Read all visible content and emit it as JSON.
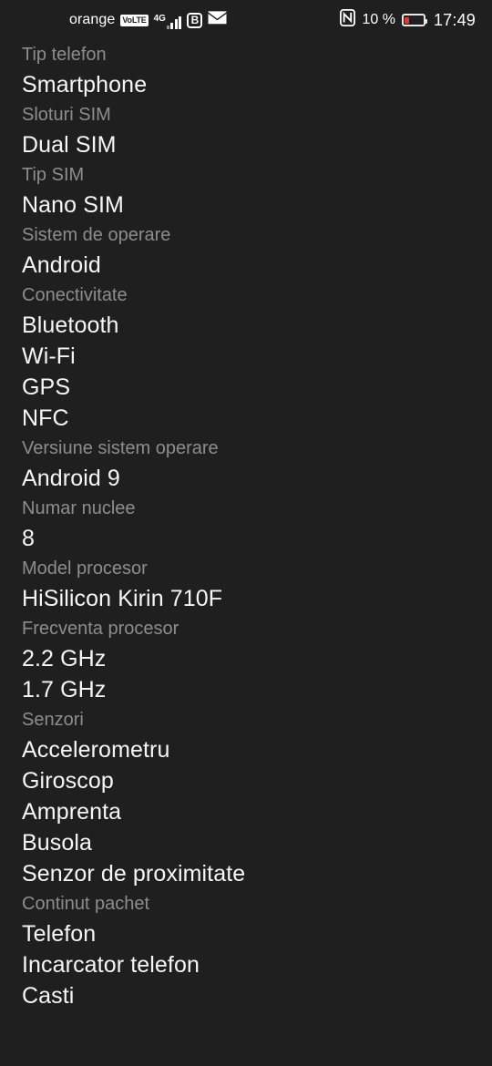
{
  "status_bar": {
    "carrier": "orange",
    "volte_badge": "VoLTE",
    "network_type": "4G",
    "signal_icon": "signal-bars-icon",
    "browser_badge": "B",
    "mail_icon": "envelope-icon",
    "nfc_icon": "nfc-icon",
    "battery_percent": "10 %",
    "battery_icon": "battery-low-icon",
    "battery_level": 10,
    "battery_color": "#e23b2e",
    "clock": "17:49"
  },
  "theme": {
    "background": "#1f1f1f",
    "label_color": "#8d8d8d",
    "value_color": "#f6f6f6"
  },
  "specs": [
    {
      "label": "Tip telefon",
      "values": [
        "Smartphone"
      ]
    },
    {
      "label": "Sloturi SIM",
      "values": [
        "Dual SIM"
      ]
    },
    {
      "label": "Tip SIM",
      "values": [
        "Nano SIM"
      ]
    },
    {
      "label": "Sistem de operare",
      "values": [
        "Android"
      ]
    },
    {
      "label": "Conectivitate",
      "values": [
        "Bluetooth",
        "Wi-Fi",
        "GPS",
        "NFC"
      ]
    },
    {
      "label": "Versiune sistem operare",
      "values": [
        "Android 9"
      ]
    },
    {
      "label": "Numar nuclee",
      "values": [
        "8"
      ]
    },
    {
      "label": "Model procesor",
      "values": [
        "HiSilicon Kirin 710F"
      ]
    },
    {
      "label": "Frecventa procesor",
      "values": [
        "2.2 GHz",
        "1.7 GHz"
      ]
    },
    {
      "label": "Senzori",
      "values": [
        "Accelerometru",
        "Giroscop",
        "Amprenta",
        "Busola",
        "Senzor de proximitate"
      ]
    },
    {
      "label": "Continut pachet",
      "values": [
        "Telefon",
        "Incarcator telefon",
        "Casti"
      ]
    }
  ]
}
